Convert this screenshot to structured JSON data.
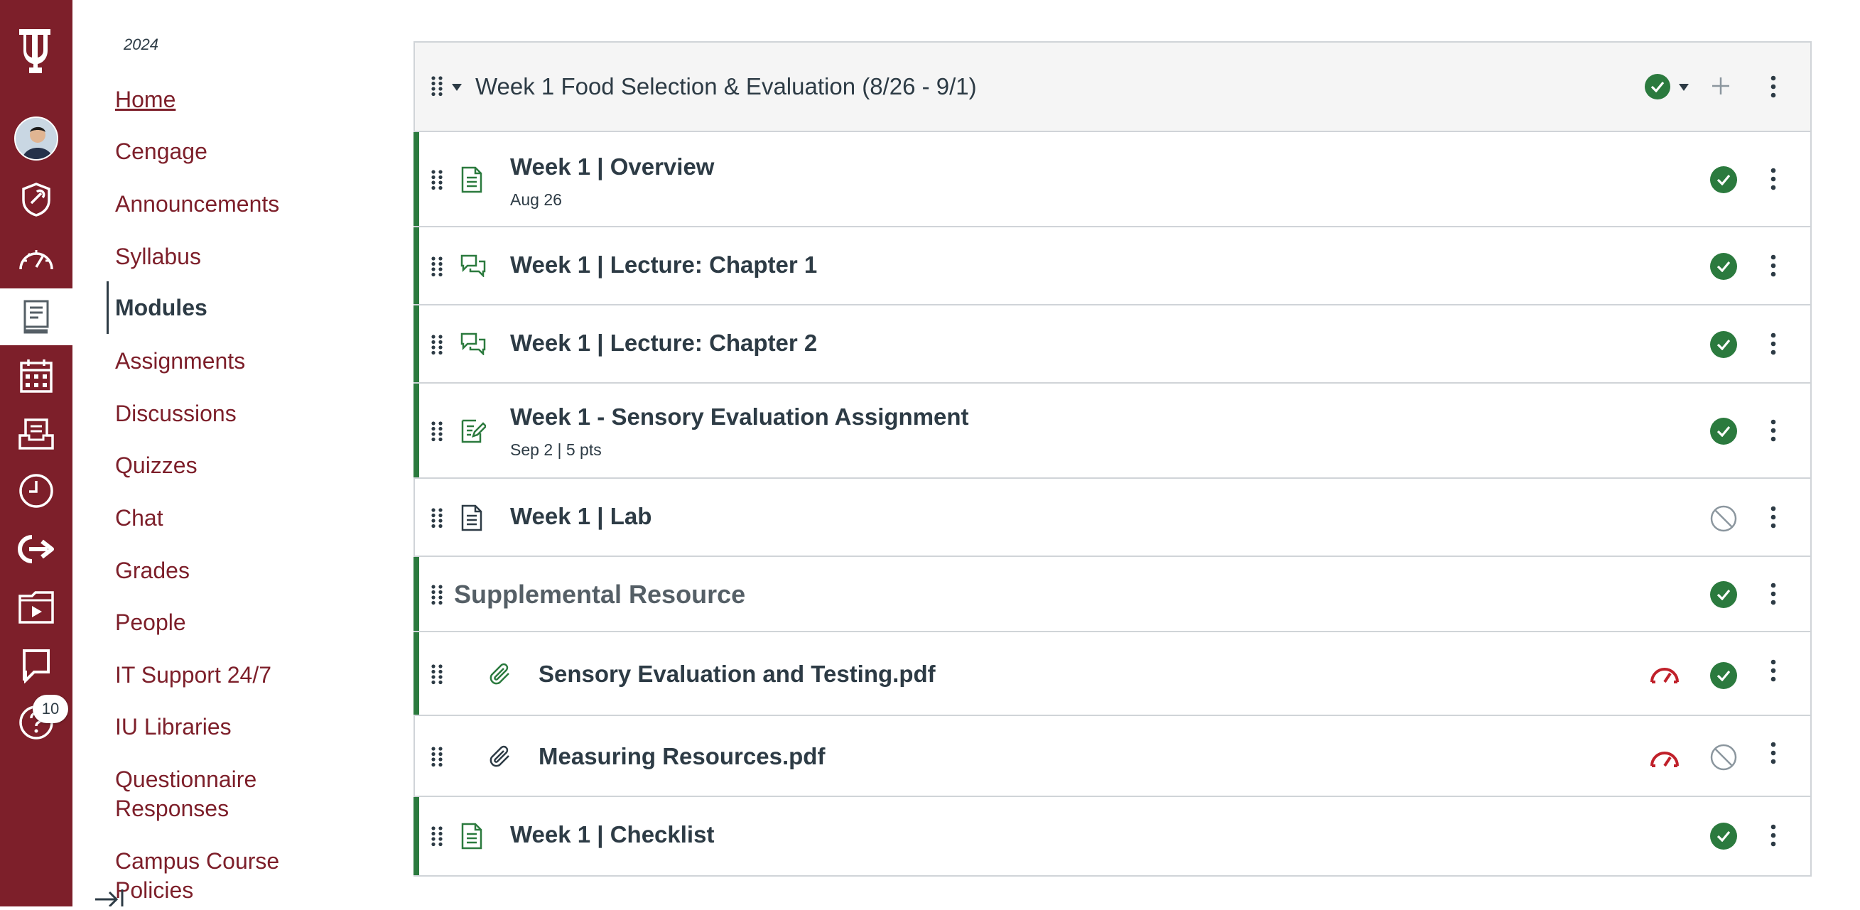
{
  "global_nav": {
    "items": [
      {
        "name": "logo",
        "icon": "iu-trident-icon"
      },
      {
        "name": "account",
        "icon": "avatar"
      },
      {
        "name": "admin",
        "icon": "shield-icon"
      },
      {
        "name": "dashboard",
        "icon": "dashboard-icon"
      },
      {
        "name": "courses",
        "icon": "book-icon",
        "active": true
      },
      {
        "name": "calendar",
        "icon": "calendar-icon"
      },
      {
        "name": "inbox",
        "icon": "inbox-icon"
      },
      {
        "name": "history",
        "icon": "clock-icon"
      },
      {
        "name": "commons",
        "icon": "share-arrow-icon"
      },
      {
        "name": "studio",
        "icon": "video-folder-icon"
      },
      {
        "name": "chat",
        "icon": "chat-flag-icon"
      },
      {
        "name": "help",
        "icon": "help-icon"
      }
    ],
    "help_badge": "10",
    "accent": "#7d1f2a"
  },
  "course_nav": {
    "term": "2024",
    "links": [
      {
        "label": "Home"
      },
      {
        "label": "Cengage"
      },
      {
        "label": "Announcements"
      },
      {
        "label": "Syllabus"
      },
      {
        "label": "Modules"
      },
      {
        "label": "Assignments"
      },
      {
        "label": "Discussions"
      },
      {
        "label": "Quizzes"
      },
      {
        "label": "Chat"
      },
      {
        "label": "Grades"
      },
      {
        "label": "People"
      },
      {
        "label": "IT Support 24/7"
      },
      {
        "label": "IU Libraries"
      },
      {
        "label": "Questionnaire Responses"
      },
      {
        "label": "Campus Course Policies"
      }
    ],
    "active": "Modules"
  },
  "module": {
    "title": "Week 1 Food Selection & Evaluation (8/26 - 9/1)",
    "items": [
      {
        "title": "Week 1 | Overview",
        "meta": "Aug 26",
        "type": "page-icon",
        "published": true
      },
      {
        "title": "Week 1 | Lecture: Chapter 1",
        "meta": "",
        "type": "discussion-icon",
        "published": true
      },
      {
        "title": "Week 1 | Lecture: Chapter 2",
        "meta": "",
        "type": "discussion-icon",
        "published": true
      },
      {
        "title": "Week 1 - Sensory Evaluation Assignment",
        "meta": "Sep 2  |  5 pts",
        "type": "assignment-icon",
        "published": true
      },
      {
        "title": "Week 1 | Lab",
        "meta": "",
        "type": "page-icon",
        "published": false
      },
      {
        "title": "Supplemental Resource",
        "meta": "",
        "type": "subheader",
        "published": true
      },
      {
        "title": "Sensory Evaluation and Testing.pdf",
        "meta": "",
        "type": "attachment-icon",
        "published": true
      },
      {
        "title": "Measuring Resources.pdf",
        "meta": "",
        "type": "attachment-icon",
        "published": false
      },
      {
        "title": "Week 1 | Checklist",
        "meta": "",
        "type": "page-icon",
        "published": true
      }
    ],
    "colors": {
      "published": "#2b7a3e",
      "border": "#d0d4d8",
      "accessibility_warning": "#c0202a"
    }
  }
}
